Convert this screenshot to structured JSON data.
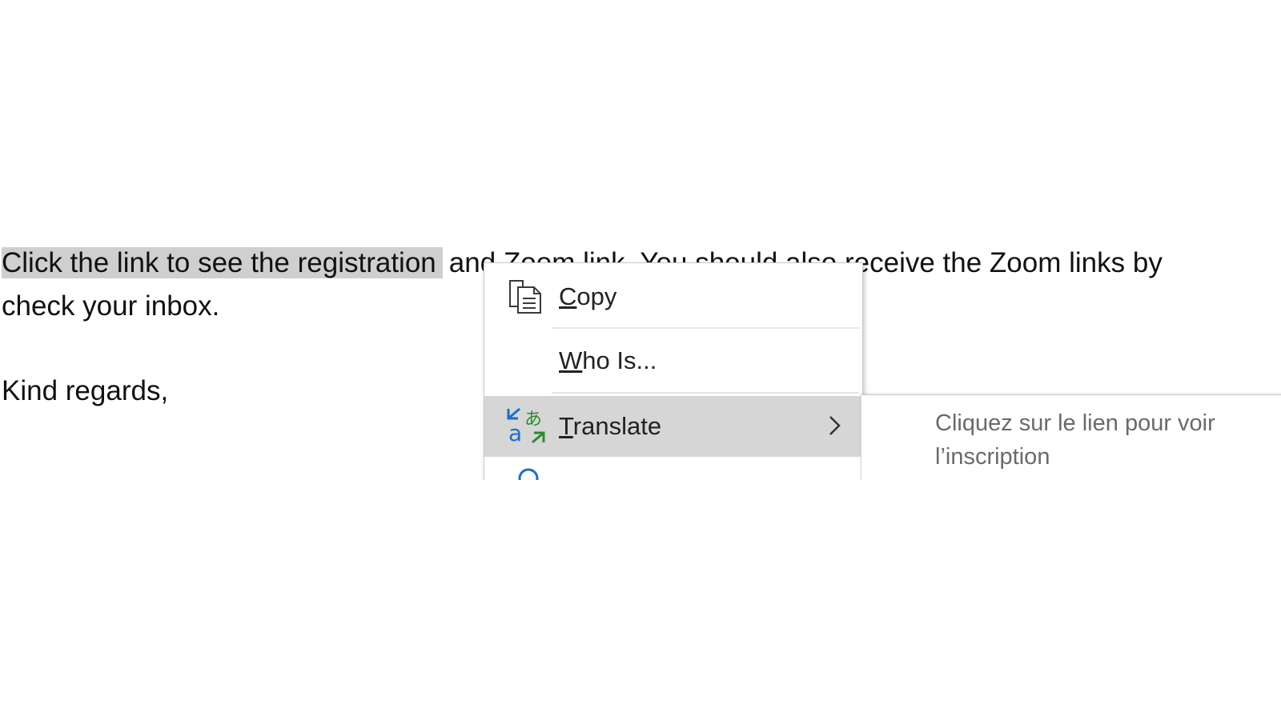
{
  "document": {
    "line1_selected": "Click the link to see the registration",
    "line1_rest": "and Zoom link. You should also receive the Zoom links by",
    "line2": "check your inbox.",
    "line3": "Kind regards,"
  },
  "context_menu": {
    "items": [
      {
        "first": "C",
        "rest": "opy",
        "icon": "copy-icon"
      },
      {
        "first": "W",
        "rest": "ho Is...",
        "icon": "none"
      },
      {
        "first": "T",
        "rest": "ranslate",
        "icon": "translate-icon",
        "submenu": true,
        "highlighted": true
      },
      {
        "icon": "lookup-icon"
      }
    ]
  },
  "translate_submenu": {
    "translation": "Cliquez sur le lien pour voir l’inscription"
  },
  "colors": {
    "selection": "#cfcfcf",
    "menu_hover": "#d6d6d6",
    "translate_blue": "#1e6fc4",
    "translate_green": "#2e8b2e",
    "translation_text": "#6a6a6a"
  }
}
